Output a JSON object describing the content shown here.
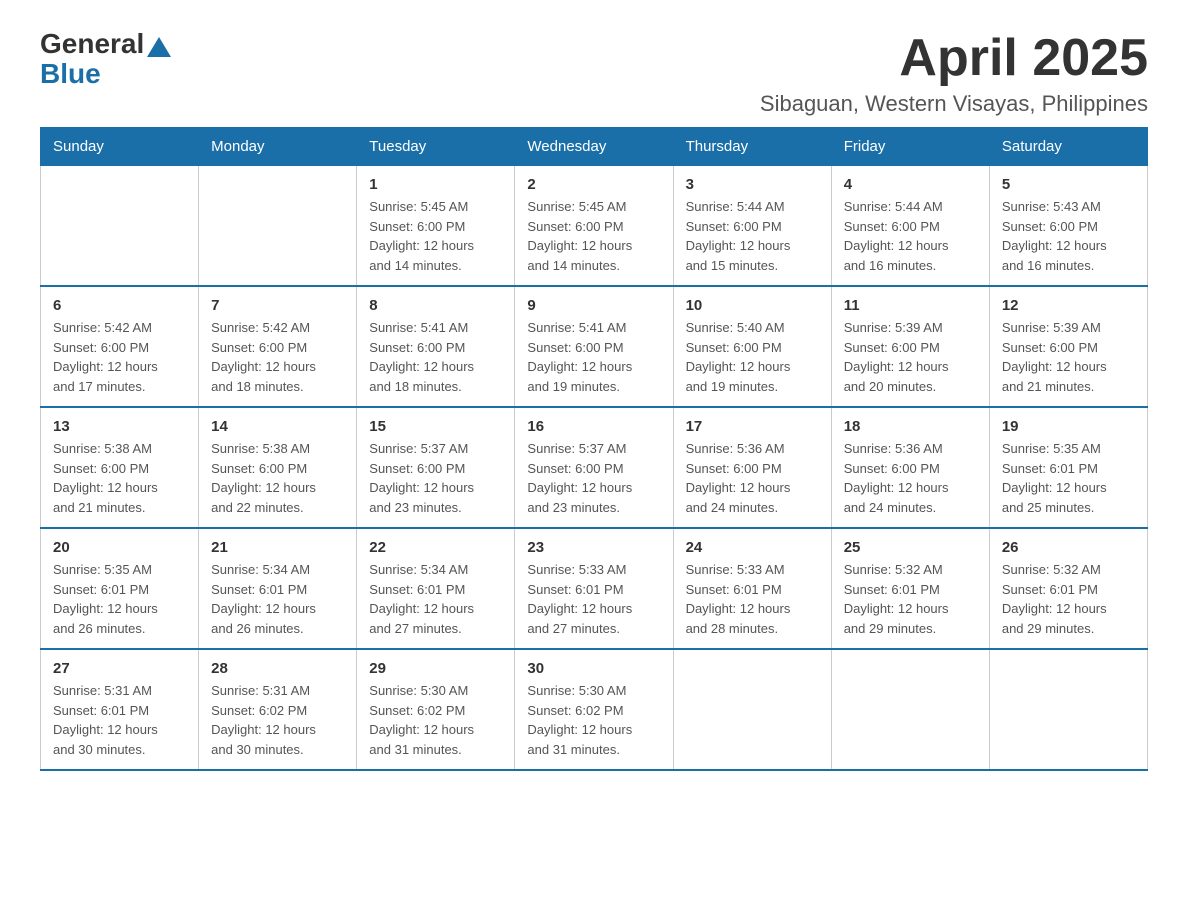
{
  "logo": {
    "general": "General",
    "blue": "Blue"
  },
  "title": "April 2025",
  "location": "Sibaguan, Western Visayas, Philippines",
  "days_of_week": [
    "Sunday",
    "Monday",
    "Tuesday",
    "Wednesday",
    "Thursday",
    "Friday",
    "Saturday"
  ],
  "weeks": [
    [
      {
        "day": "",
        "info": ""
      },
      {
        "day": "",
        "info": ""
      },
      {
        "day": "1",
        "info": "Sunrise: 5:45 AM\nSunset: 6:00 PM\nDaylight: 12 hours\nand 14 minutes."
      },
      {
        "day": "2",
        "info": "Sunrise: 5:45 AM\nSunset: 6:00 PM\nDaylight: 12 hours\nand 14 minutes."
      },
      {
        "day": "3",
        "info": "Sunrise: 5:44 AM\nSunset: 6:00 PM\nDaylight: 12 hours\nand 15 minutes."
      },
      {
        "day": "4",
        "info": "Sunrise: 5:44 AM\nSunset: 6:00 PM\nDaylight: 12 hours\nand 16 minutes."
      },
      {
        "day": "5",
        "info": "Sunrise: 5:43 AM\nSunset: 6:00 PM\nDaylight: 12 hours\nand 16 minutes."
      }
    ],
    [
      {
        "day": "6",
        "info": "Sunrise: 5:42 AM\nSunset: 6:00 PM\nDaylight: 12 hours\nand 17 minutes."
      },
      {
        "day": "7",
        "info": "Sunrise: 5:42 AM\nSunset: 6:00 PM\nDaylight: 12 hours\nand 18 minutes."
      },
      {
        "day": "8",
        "info": "Sunrise: 5:41 AM\nSunset: 6:00 PM\nDaylight: 12 hours\nand 18 minutes."
      },
      {
        "day": "9",
        "info": "Sunrise: 5:41 AM\nSunset: 6:00 PM\nDaylight: 12 hours\nand 19 minutes."
      },
      {
        "day": "10",
        "info": "Sunrise: 5:40 AM\nSunset: 6:00 PM\nDaylight: 12 hours\nand 19 minutes."
      },
      {
        "day": "11",
        "info": "Sunrise: 5:39 AM\nSunset: 6:00 PM\nDaylight: 12 hours\nand 20 minutes."
      },
      {
        "day": "12",
        "info": "Sunrise: 5:39 AM\nSunset: 6:00 PM\nDaylight: 12 hours\nand 21 minutes."
      }
    ],
    [
      {
        "day": "13",
        "info": "Sunrise: 5:38 AM\nSunset: 6:00 PM\nDaylight: 12 hours\nand 21 minutes."
      },
      {
        "day": "14",
        "info": "Sunrise: 5:38 AM\nSunset: 6:00 PM\nDaylight: 12 hours\nand 22 minutes."
      },
      {
        "day": "15",
        "info": "Sunrise: 5:37 AM\nSunset: 6:00 PM\nDaylight: 12 hours\nand 23 minutes."
      },
      {
        "day": "16",
        "info": "Sunrise: 5:37 AM\nSunset: 6:00 PM\nDaylight: 12 hours\nand 23 minutes."
      },
      {
        "day": "17",
        "info": "Sunrise: 5:36 AM\nSunset: 6:00 PM\nDaylight: 12 hours\nand 24 minutes."
      },
      {
        "day": "18",
        "info": "Sunrise: 5:36 AM\nSunset: 6:00 PM\nDaylight: 12 hours\nand 24 minutes."
      },
      {
        "day": "19",
        "info": "Sunrise: 5:35 AM\nSunset: 6:01 PM\nDaylight: 12 hours\nand 25 minutes."
      }
    ],
    [
      {
        "day": "20",
        "info": "Sunrise: 5:35 AM\nSunset: 6:01 PM\nDaylight: 12 hours\nand 26 minutes."
      },
      {
        "day": "21",
        "info": "Sunrise: 5:34 AM\nSunset: 6:01 PM\nDaylight: 12 hours\nand 26 minutes."
      },
      {
        "day": "22",
        "info": "Sunrise: 5:34 AM\nSunset: 6:01 PM\nDaylight: 12 hours\nand 27 minutes."
      },
      {
        "day": "23",
        "info": "Sunrise: 5:33 AM\nSunset: 6:01 PM\nDaylight: 12 hours\nand 27 minutes."
      },
      {
        "day": "24",
        "info": "Sunrise: 5:33 AM\nSunset: 6:01 PM\nDaylight: 12 hours\nand 28 minutes."
      },
      {
        "day": "25",
        "info": "Sunrise: 5:32 AM\nSunset: 6:01 PM\nDaylight: 12 hours\nand 29 minutes."
      },
      {
        "day": "26",
        "info": "Sunrise: 5:32 AM\nSunset: 6:01 PM\nDaylight: 12 hours\nand 29 minutes."
      }
    ],
    [
      {
        "day": "27",
        "info": "Sunrise: 5:31 AM\nSunset: 6:01 PM\nDaylight: 12 hours\nand 30 minutes."
      },
      {
        "day": "28",
        "info": "Sunrise: 5:31 AM\nSunset: 6:02 PM\nDaylight: 12 hours\nand 30 minutes."
      },
      {
        "day": "29",
        "info": "Sunrise: 5:30 AM\nSunset: 6:02 PM\nDaylight: 12 hours\nand 31 minutes."
      },
      {
        "day": "30",
        "info": "Sunrise: 5:30 AM\nSunset: 6:02 PM\nDaylight: 12 hours\nand 31 minutes."
      },
      {
        "day": "",
        "info": ""
      },
      {
        "day": "",
        "info": ""
      },
      {
        "day": "",
        "info": ""
      }
    ]
  ]
}
